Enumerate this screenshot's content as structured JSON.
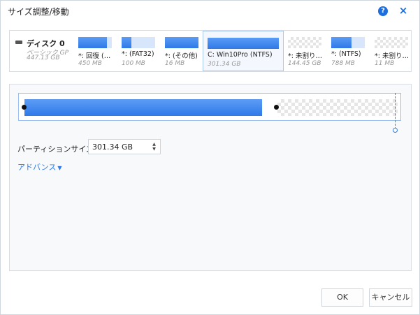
{
  "dialog": {
    "title": "サイズ調整/移動",
    "help_icon": "?",
    "close_icon": "×"
  },
  "disk": {
    "name": "ディスク 0",
    "type": "ベーシック GP",
    "size": "447.13 GB",
    "icon": "disk-icon"
  },
  "partitions": [
    {
      "label": "*: 回復 (…",
      "size": "450 MB",
      "fill": 0.85,
      "unallocated": false,
      "selected": false
    },
    {
      "label": "*: (FAT32)",
      "size": "100 MB",
      "fill": 0.3,
      "unallocated": false,
      "selected": false
    },
    {
      "label": "*: (その他)",
      "size": "16 MB",
      "fill": 1.0,
      "unallocated": false,
      "selected": false
    },
    {
      "label": "C: Win10Pro (NTFS)",
      "size": "301.34 GB",
      "fill": 1.0,
      "unallocated": false,
      "selected": true
    },
    {
      "label": "*: 未割り…",
      "size": "144.45 GB",
      "fill": 0,
      "unallocated": true,
      "selected": false
    },
    {
      "label": "*: (NTFS)",
      "size": "788 MB",
      "fill": 0.6,
      "unallocated": false,
      "selected": false
    },
    {
      "label": "*: 未割り…",
      "size": "11 MB",
      "fill": 0,
      "unallocated": true,
      "selected": false
    }
  ],
  "resize": {
    "partition_size_label": "パーティションサイズ:",
    "partition_size_value": "301.34 GB",
    "advanced_label": "アドバンス",
    "used_fraction": 0.62
  },
  "buttons": {
    "ok": "OK",
    "cancel": "キャンセル"
  },
  "colors": {
    "accent": "#2f7ae8",
    "partition_fill": "#4a8ef2",
    "selected_border": "#a9c8f0"
  }
}
